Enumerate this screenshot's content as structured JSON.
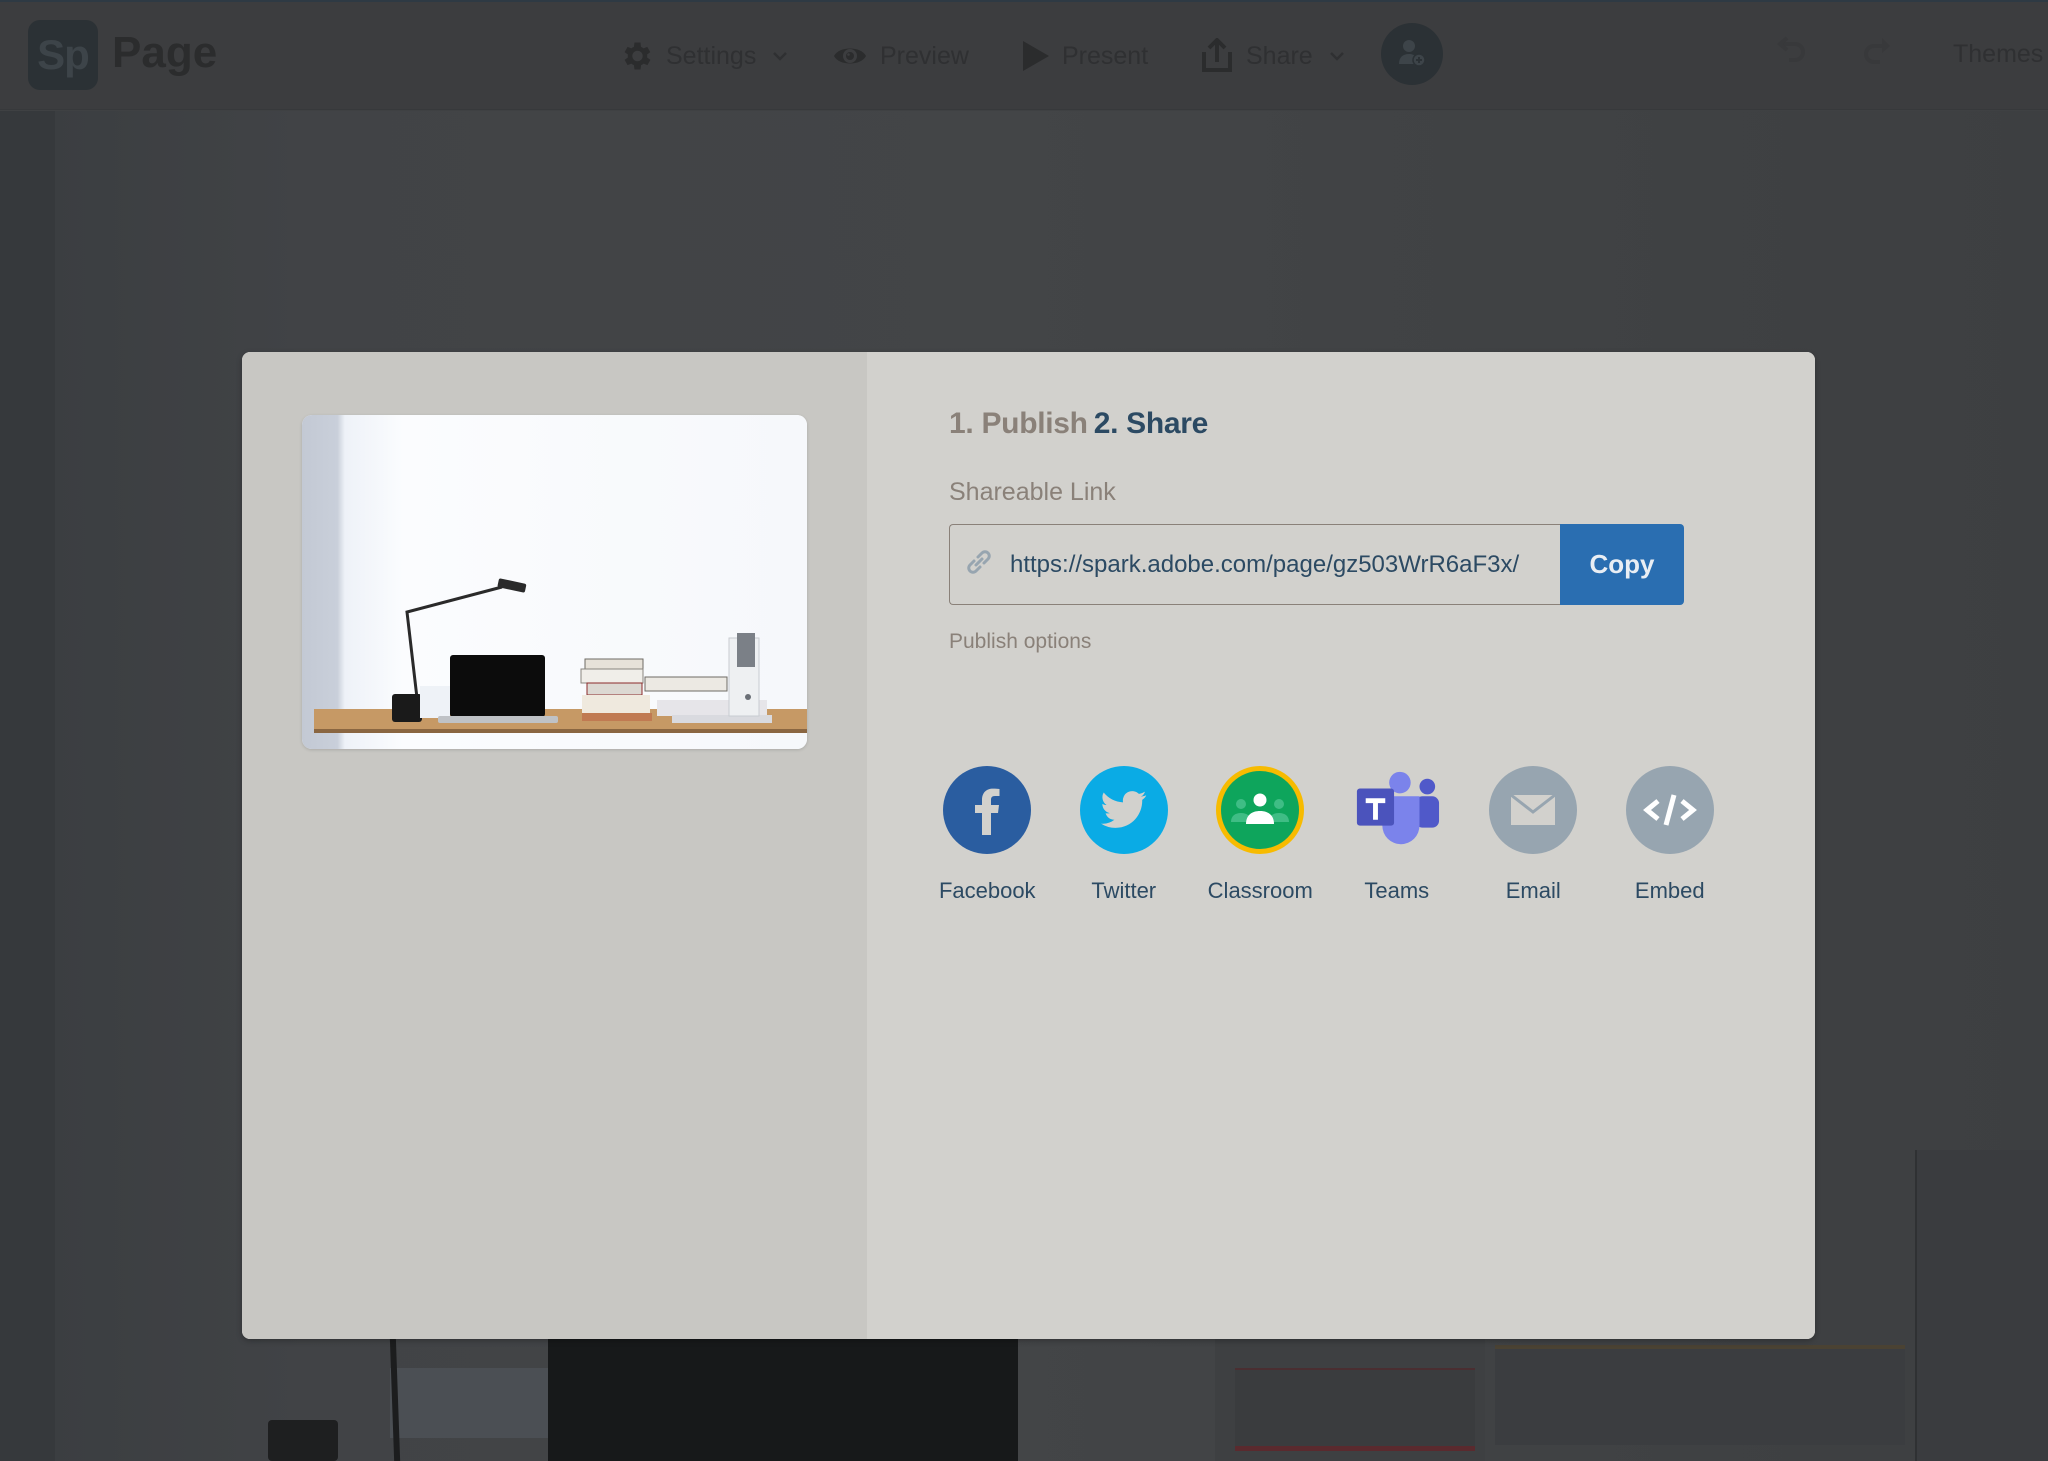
{
  "app": {
    "logo_text": "Sp",
    "name": "Page"
  },
  "toolbar": {
    "settings_label": "Settings",
    "preview_label": "Preview",
    "present_label": "Present",
    "share_label": "Share",
    "themes_label": "Themes",
    "chevron_glyph": "⌄"
  },
  "modal": {
    "step1": "1. Publish",
    "step2": "2. Share",
    "shareable_link_label": "Shareable Link",
    "link_url": "https://spark.adobe.com/page/gz503WrR6aF3x/",
    "copy_label": "Copy",
    "publish_options_label": "Publish options",
    "share_targets": [
      {
        "label": "Facebook",
        "icon": "facebook-icon",
        "color": "#2a5da0"
      },
      {
        "label": "Twitter",
        "icon": "twitter-icon",
        "color": "#0aabe5"
      },
      {
        "label": "Classroom",
        "icon": "google-classroom-icon",
        "color": "#0ea55c",
        "ring": "#f7bb00"
      },
      {
        "label": "Teams",
        "icon": "microsoft-teams-icon",
        "color": "#4b53bc"
      },
      {
        "label": "Email",
        "icon": "email-icon",
        "color": "#97a5b0"
      },
      {
        "label": "Embed",
        "icon": "embed-code-icon",
        "color": "#97a5b0"
      }
    ]
  },
  "colors": {
    "accent_blue": "#2a6eb1",
    "title_navy": "#2c4a63",
    "muted_taupe": "#8a8179"
  }
}
